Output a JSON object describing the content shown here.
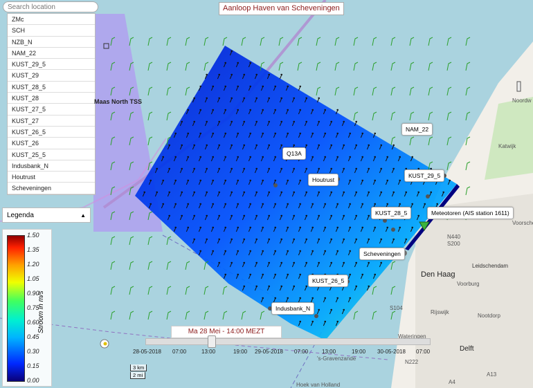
{
  "title": "Aanloop Haven van Scheveningen",
  "search": {
    "placeholder": "Search location"
  },
  "locations": [
    "ZMc",
    "SCH",
    "NZB_N",
    "NAM_22",
    "KUST_29_5",
    "KUST_29",
    "KUST_28_5",
    "KUST_28",
    "KUST_27_5",
    "KUST_27",
    "KUST_26_5",
    "KUST_26",
    "KUST_25_5",
    "Indusbank_N",
    "Houtrust",
    "Scheveningen"
  ],
  "legend": {
    "button_label": "Legenda",
    "unit_label": "Stroom in m/s",
    "ticks": [
      "1.50",
      "1.35",
      "1.20",
      "1.05",
      "0.90",
      "0.75",
      "0.60",
      "0.45",
      "0.30",
      "0.15",
      "0.00"
    ]
  },
  "map_labels": {
    "tss": "Maas North TSS",
    "q13a": "Q13A",
    "houtrust": "Houtrust",
    "nam22": "NAM_22",
    "kust29_5": "KUST_29_5",
    "kust28_5": "KUST_28_5",
    "meteotoren": "Meteotoren (AIS station 1611)",
    "scheveningen": "Scheveningen",
    "kust26_5": "KUST_26_5",
    "indusbank": "Indusbank_N"
  },
  "places": {
    "noordwijk": "Noordw",
    "katwijk": "Katwijk",
    "voorschoten": "Voorscho",
    "leidschendam": "Leidschendam",
    "den_haag": "Den Haag",
    "voorburg": "Voorburg",
    "rijswijk": "Rijswijk",
    "nootdorp": "Nootdorp",
    "wateringen": "Wateringen",
    "delft": "Delft",
    "s_gravenzande": "'s-Gravenzande",
    "hoek": "Hoek van Holland",
    "n440": "N440",
    "s200": "S200",
    "s104": "S104",
    "n222": "N222",
    "a4": "A4",
    "a13": "A13"
  },
  "time": {
    "current": "Ma 28 Mei - 14:00 MEZT",
    "labels": [
      "28-05-2018",
      "07:00",
      "13:00",
      "19:00",
      "29-05-2018",
      "07:00",
      "13:00",
      "19:00",
      "30-05-2018",
      "07:00"
    ]
  },
  "scale": {
    "km": "3 km",
    "mi": "2 mi"
  },
  "colors": {
    "water": "#aad3df",
    "land": "#f2efe9",
    "tss": "#b0a0f0",
    "title_text": "#8b1a1a"
  }
}
